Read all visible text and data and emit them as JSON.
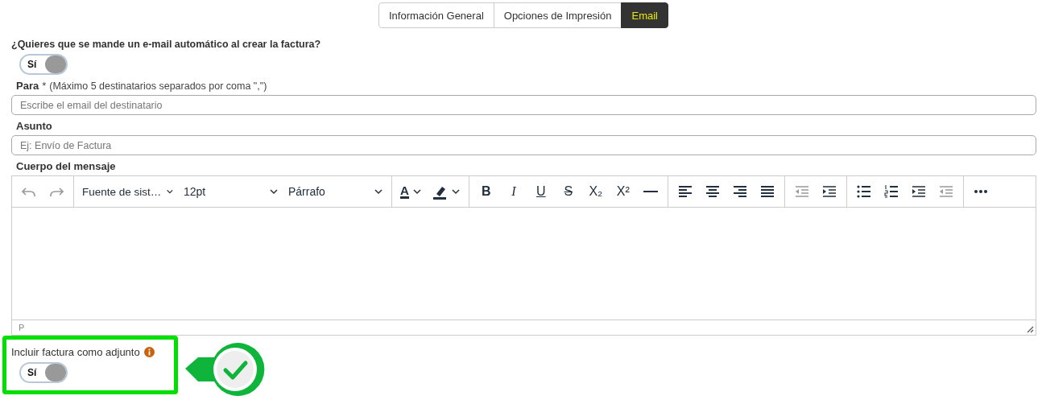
{
  "tabs": [
    {
      "label": "Información General",
      "selected": false
    },
    {
      "label": "Opciones de Impresión",
      "selected": false
    },
    {
      "label": "Email",
      "selected": true
    }
  ],
  "auto_email": {
    "question": "¿Quieres que se mande un e-mail automático al crear la factura?",
    "toggle": {
      "label": "Sí",
      "on": true
    }
  },
  "to": {
    "label": "Para",
    "required_mark": "*",
    "hint": "(Máximo 5 destinatarios separados por coma \",\")",
    "placeholder": "Escribe el email del destinatario"
  },
  "subject": {
    "label": "Asunto",
    "placeholder": "Ej: Envío de Factura"
  },
  "body": {
    "label": "Cuerpo del mensaje",
    "toolbar": [
      [
        {
          "kind": "icon",
          "disabled": true
        },
        {
          "kind": "icon",
          "disabled": true
        }
      ],
      [
        {
          "kind": "select",
          "label": "Fuente de sist…"
        },
        {
          "kind": "select",
          "label": "12pt"
        },
        {
          "kind": "select",
          "label": "Párrafo"
        }
      ],
      [
        {
          "kind": "split",
          "label": "A"
        },
        {
          "kind": "split"
        }
      ],
      [
        {
          "kind": "text",
          "label": "B"
        },
        {
          "kind": "text",
          "label": "I"
        },
        {
          "kind": "text",
          "label": "U"
        },
        {
          "kind": "text",
          "label": "S"
        },
        {
          "kind": "text",
          "label": "X₂"
        },
        {
          "kind": "text",
          "label": "X²"
        },
        {
          "kind": "icon",
          "disabled": false
        }
      ],
      [
        {
          "kind": "icon",
          "disabled": false
        },
        {
          "kind": "icon",
          "disabled": false
        },
        {
          "kind": "icon",
          "disabled": false
        },
        {
          "kind": "icon",
          "disabled": false
        }
      ],
      [
        {
          "kind": "icon",
          "disabled": true
        },
        {
          "kind": "icon",
          "disabled": false
        }
      ],
      [
        {
          "kind": "icon",
          "disabled": false
        },
        {
          "kind": "icon",
          "disabled": false
        },
        {
          "kind": "icon",
          "disabled": false
        },
        {
          "kind": "icon",
          "disabled": true
        }
      ],
      [
        {
          "kind": "icon",
          "disabled": false
        }
      ]
    ],
    "path": "P"
  },
  "attachment": {
    "label": "Incluir factura como adjunto",
    "toggle": {
      "label": "Sí",
      "on": true
    }
  }
}
